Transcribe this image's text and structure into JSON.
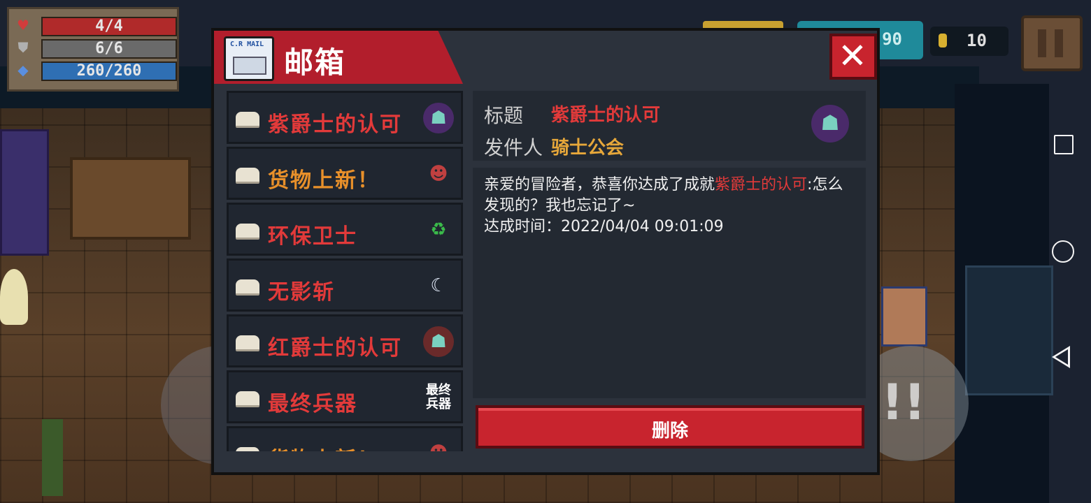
{
  "hud": {
    "health": "4/4",
    "shield": "6/6",
    "energy": "260/260",
    "coins": "10",
    "gems_partial": "90"
  },
  "mailbox": {
    "title": "邮箱",
    "icon_label": "C.R MAIL",
    "items": [
      {
        "name": "紫爵士的认可",
        "color": "red",
        "icon": "purple-knight-icon"
      },
      {
        "name": "货物上新！",
        "color": "orange",
        "icon": "shopkeeper-icon"
      },
      {
        "name": "环保卫士",
        "color": "red",
        "icon": "recycle-icon"
      },
      {
        "name": "无影斩",
        "color": "red",
        "icon": "crescent-slash-icon"
      },
      {
        "name": "红爵士的认可",
        "color": "red",
        "icon": "red-knight-icon"
      },
      {
        "name": "最终兵器",
        "color": "red",
        "icon": "ultimate-weapon-icon"
      },
      {
        "name": "货物上新！",
        "color": "orange",
        "icon": "shopkeeper-icon"
      }
    ],
    "weapon_icon_text": "最终\n兵器",
    "detail": {
      "subject_label": "标题",
      "subject": "紫爵士的认可",
      "sender_label": "发件人",
      "sender": "骑士公会",
      "body_prefix": "亲爱的冒险者，恭喜你达成了成就",
      "body_highlight": "紫爵士的认可",
      "body_suffix": ":怎么发现的？我也忘记了~",
      "body_time": "达成时间：2022/04/04 09:01:09"
    },
    "delete_label": "删除",
    "close_symbol": "✕"
  },
  "colors": {
    "accent_red": "#c8242e",
    "title_red": "#e23a3a",
    "orange": "#e8902a",
    "gold": "#e6a73a",
    "panel": "#2c323c"
  }
}
